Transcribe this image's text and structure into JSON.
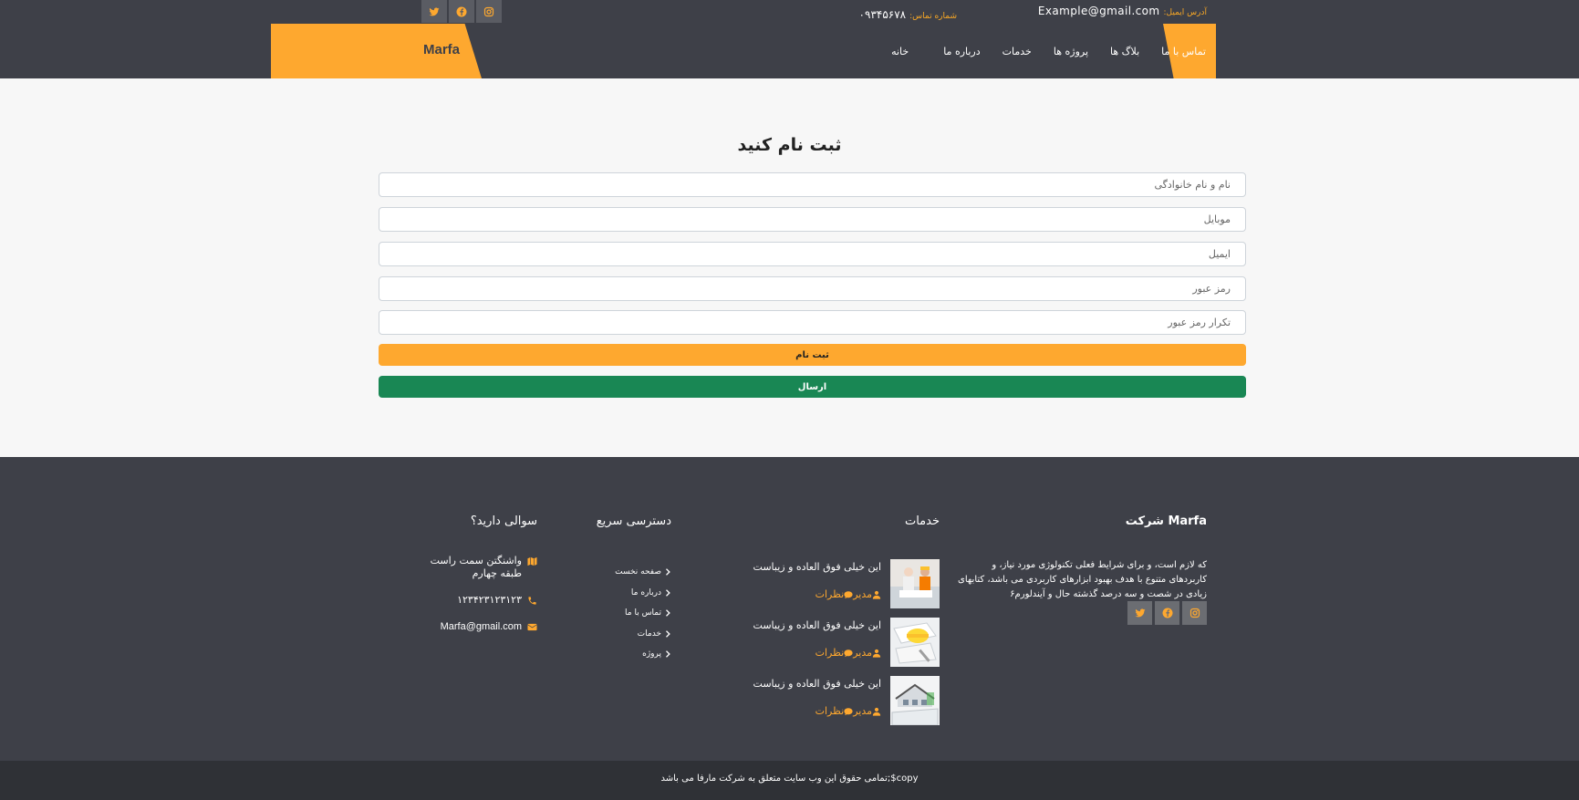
{
  "topbar": {
    "email_label": "آدرس ایمیل:",
    "email_value": "Example@gmail.com",
    "phone_label": "شماره تماس:",
    "phone_value": "۰۹۳۴۵۶۷۸",
    "social_icons": [
      "instagram-icon",
      "facebook-icon",
      "twitter-icon"
    ]
  },
  "nav": {
    "logo": "Marfa",
    "items": [
      "خانه",
      "درباره ما",
      "خدمات",
      "پروژه ها",
      "بلاگ ها",
      "تماس با ما"
    ],
    "active_index": 0
  },
  "form": {
    "title": "ثبت نام کنید",
    "fields": [
      {
        "placeholder": "نام و نام خانوادگی"
      },
      {
        "placeholder": "موبایل"
      },
      {
        "placeholder": "ایمیل"
      },
      {
        "placeholder": "رمز عبور"
      },
      {
        "placeholder": "تکرار رمز عبور"
      }
    ],
    "register_label": "ثبت نام",
    "send_label": "ارسال"
  },
  "footer": {
    "about": {
      "title": "Marfa شرکت",
      "text": "که لازم است، و برای شرایط فعلی تکنولوژی مورد نیاز، و کاربردهای متنوع با هدف بهبود ابزارهای کاربردی می باشد، کتابهای زیادی در شصت و سه درصد گذشته حال و آیندلورم۶"
    },
    "services": {
      "title": "خدمات",
      "posts": [
        {
          "title": "این خیلی فوق العاده و زیباست",
          "author": "مدیر",
          "comments": "نظرات"
        },
        {
          "title": "این خیلی فوق العاده و زیباست",
          "author": "مدیر",
          "comments": "نظرات"
        },
        {
          "title": "این خیلی فوق العاده و زیباست",
          "author": "مدیر",
          "comments": "نظرات"
        }
      ]
    },
    "quick": {
      "title": "دسترسی سریع",
      "links": [
        "صفحه نخست",
        "درباره ما",
        "تماس با ما",
        "خدمات",
        "پروژه"
      ]
    },
    "contact": {
      "title": "سوالی دارید؟",
      "address_line1": "واشنگتن سمت راست",
      "address_line2": "طبقه چهارم",
      "phone": "۱۲۳۴۲۳۱۲۳۱۲۳",
      "email": "Marfa@gmail.com"
    },
    "copyright": "copy$;تمامی حقوق این وب سایت متعلق به شرکت مارفا می باشد"
  },
  "colors": {
    "accent": "#fea82f",
    "dark": "#3e4048",
    "success": "#198754"
  }
}
